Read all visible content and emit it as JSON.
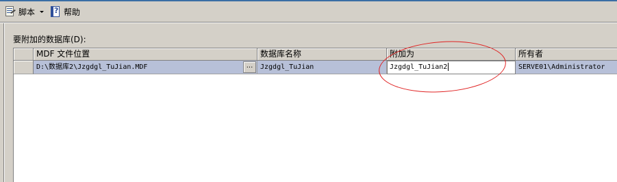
{
  "toolbar": {
    "script_label": "脚本",
    "script_icon": "script-icon",
    "help_label": "帮助",
    "help_icon": "help-icon"
  },
  "section_label": "要附加的数据库(D):",
  "grid": {
    "columns": [
      "MDF 文件位置",
      "数据库名称",
      "附加为",
      "所有者"
    ],
    "rows": [
      {
        "mdf_location": "D:\\数据库2\\Jzgdgl_TuJian.MDF",
        "browse_label": "...",
        "database_name": "Jzgdgl_TuJian",
        "attach_as": "Jzgdgl_TuJian2",
        "owner": "SERVE01\\Administrator"
      }
    ]
  },
  "colors": {
    "selected_row": "#b7c0d8",
    "highlight_ellipse": "#e02020",
    "window_bg": "#d4d0c8"
  }
}
